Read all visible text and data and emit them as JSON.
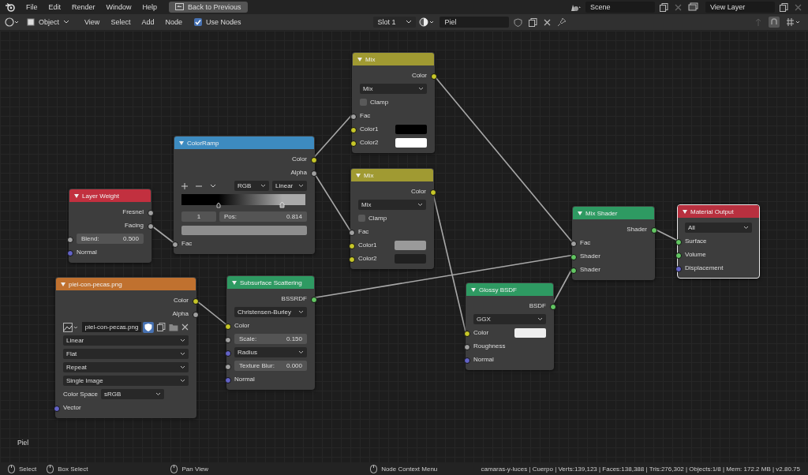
{
  "top_bar": {
    "menus": [
      "File",
      "Edit",
      "Render",
      "Window",
      "Help"
    ],
    "back_button": "Back to Previous",
    "scene": "Scene",
    "view_layer": "View Layer"
  },
  "header": {
    "mode": "Object",
    "menus": [
      "View",
      "Select",
      "Add",
      "Node"
    ],
    "use_nodes": {
      "label": "Use Nodes",
      "checked": true
    },
    "slot": "Slot 1",
    "material": "Piel"
  },
  "nodes": [
    {
      "title": "Mix",
      "color": "#a09a32",
      "selected": false,
      "rows": [
        {
          "kind": "output",
          "label": "Color",
          "color": "#c7c729"
        },
        {
          "kind": "dropdown",
          "value": "Mix"
        },
        {
          "kind": "checkbox",
          "label": "Clamp",
          "checked": false
        },
        {
          "kind": "input",
          "label": "Fac",
          "color": "#a1a1a1"
        },
        {
          "kind": "color_input",
          "label": "Color1",
          "color": "#c7c729",
          "swatch": {
            "color": "#000000"
          }
        },
        {
          "kind": "color_input",
          "label": "Color2",
          "color": "#c7c729",
          "swatch": {
            "color": "#ffffff"
          }
        }
      ]
    },
    {
      "title": "ColorRamp",
      "color": "#3d8bc0",
      "selected": false,
      "rows": [
        {
          "kind": "output",
          "label": "Color",
          "color": "#c7c729"
        },
        {
          "kind": "output",
          "label": "Alpha",
          "color": "#a1a1a1"
        },
        {
          "kind": "ramp_controls",
          "mode": "RGB",
          "interpolation": "Linear"
        },
        {
          "kind": "ramp"
        },
        {
          "kind": "ramp_pos",
          "index": "1",
          "label": "Pos:",
          "value": "0.814"
        },
        {
          "kind": "swatch_bar",
          "swatch": {
            "color": "#8e8e8e"
          }
        },
        {
          "kind": "input",
          "label": "Fac",
          "color": "#a1a1a1"
        }
      ]
    },
    {
      "title": "Layer Weight",
      "color": "#c2303f",
      "selected": false,
      "rows": [
        {
          "kind": "output",
          "label": "Fresnel",
          "color": "#a1a1a1"
        },
        {
          "kind": "output",
          "label": "Facing",
          "color": "#a1a1a1"
        },
        {
          "kind": "field",
          "label": "Blend:",
          "value": "0.500",
          "color": "#a1a1a1"
        },
        {
          "kind": "input",
          "label": "Normal",
          "color": "#6363c7"
        }
      ]
    },
    {
      "title": "Mix",
      "color": "#a09a32",
      "selected": false,
      "rows": [
        {
          "kind": "output",
          "label": "Color",
          "color": "#c7c729"
        },
        {
          "kind": "dropdown",
          "value": "Mix"
        },
        {
          "kind": "checkbox",
          "label": "Clamp",
          "checked": false
        },
        {
          "kind": "input",
          "label": "Fac",
          "color": "#a1a1a1"
        },
        {
          "kind": "color_input",
          "label": "Color1",
          "color": "#c7c729",
          "swatch": {
            "color": "#9a9a9a"
          }
        },
        {
          "kind": "color_input",
          "label": "Color2",
          "color": "#c7c729",
          "swatch": {
            "color": "#202020"
          }
        }
      ]
    },
    {
      "title": "Mix Shader",
      "color": "#2e9a62",
      "selected": false,
      "rows": [
        {
          "kind": "output",
          "label": "Shader",
          "color": "#63c763"
        },
        {
          "kind": "input",
          "label": "Fac",
          "color": "#a1a1a1"
        },
        {
          "kind": "input",
          "label": "Shader",
          "color": "#63c763"
        },
        {
          "kind": "input",
          "label": "Shader",
          "color": "#63c763"
        }
      ]
    },
    {
      "title": "Material Output",
      "color": "#b8303f",
      "selected": true,
      "rows": [
        {
          "kind": "dropdown",
          "value": "All"
        },
        {
          "kind": "input",
          "label": "Surface",
          "color": "#63c763"
        },
        {
          "kind": "input",
          "label": "Volume",
          "color": "#63c763"
        },
        {
          "kind": "input",
          "label": "Displacement",
          "color": "#6363c7"
        }
      ]
    },
    {
      "title": "piel-con-pecas.png",
      "color": "#c0712f",
      "selected": false,
      "rows": [
        {
          "kind": "output",
          "label": "Color",
          "color": "#c7c729"
        },
        {
          "kind": "output",
          "label": "Alpha",
          "color": "#a1a1a1"
        },
        {
          "kind": "image",
          "value": "piel-con-pecas.png"
        },
        {
          "kind": "dropdown",
          "value": "Linear"
        },
        {
          "kind": "dropdown",
          "value": "Flat"
        },
        {
          "kind": "dropdown",
          "value": "Repeat"
        },
        {
          "kind": "dropdown",
          "value": "Single Image"
        },
        {
          "kind": "labeled_dropdown",
          "label": "Color Space",
          "value": "sRGB"
        },
        {
          "kind": "input",
          "label": "Vector",
          "color": "#6363c7"
        }
      ]
    },
    {
      "title": "Subsurface Scattering",
      "color": "#2e9a62",
      "selected": false,
      "rows": [
        {
          "kind": "output",
          "label": "BSSRDF",
          "color": "#63c763"
        },
        {
          "kind": "dropdown",
          "value": "Christensen-Burley"
        },
        {
          "kind": "input",
          "label": "Color",
          "color": "#c7c729"
        },
        {
          "kind": "field",
          "label": "Scale:",
          "value": "0.150",
          "color": "#a1a1a1"
        },
        {
          "kind": "dropdown",
          "value": "Radius",
          "color": "#6363c7"
        },
        {
          "kind": "field",
          "label": "Texture Blur:",
          "value": "0.000",
          "color": "#a1a1a1"
        },
        {
          "kind": "input",
          "label": "Normal",
          "color": "#6363c7"
        }
      ]
    },
    {
      "title": "Glossy BSDF",
      "color": "#2e9a62",
      "selected": false,
      "rows": [
        {
          "kind": "output",
          "label": "BSDF",
          "color": "#63c763"
        },
        {
          "kind": "dropdown",
          "value": "GGX"
        },
        {
          "kind": "color_input",
          "label": "Color",
          "color": "#c7c729",
          "swatch": {
            "color": "#eeeeee"
          }
        },
        {
          "kind": "input",
          "label": "Roughness",
          "color": "#a1a1a1"
        },
        {
          "kind": "input",
          "label": "Normal",
          "color": "#6363c7"
        }
      ]
    }
  ],
  "material_label": "Piel",
  "status_bar": {
    "hints": [
      "Select",
      "Box Select",
      "Pan View",
      "Node Context Menu"
    ],
    "stats": "camaras-y-luces | Cuerpo | Verts:139,123 | Faces:138,388 | Tris:276,302 | Objects:1/8 | Mem: 172.2 MB | v2.80.75"
  }
}
